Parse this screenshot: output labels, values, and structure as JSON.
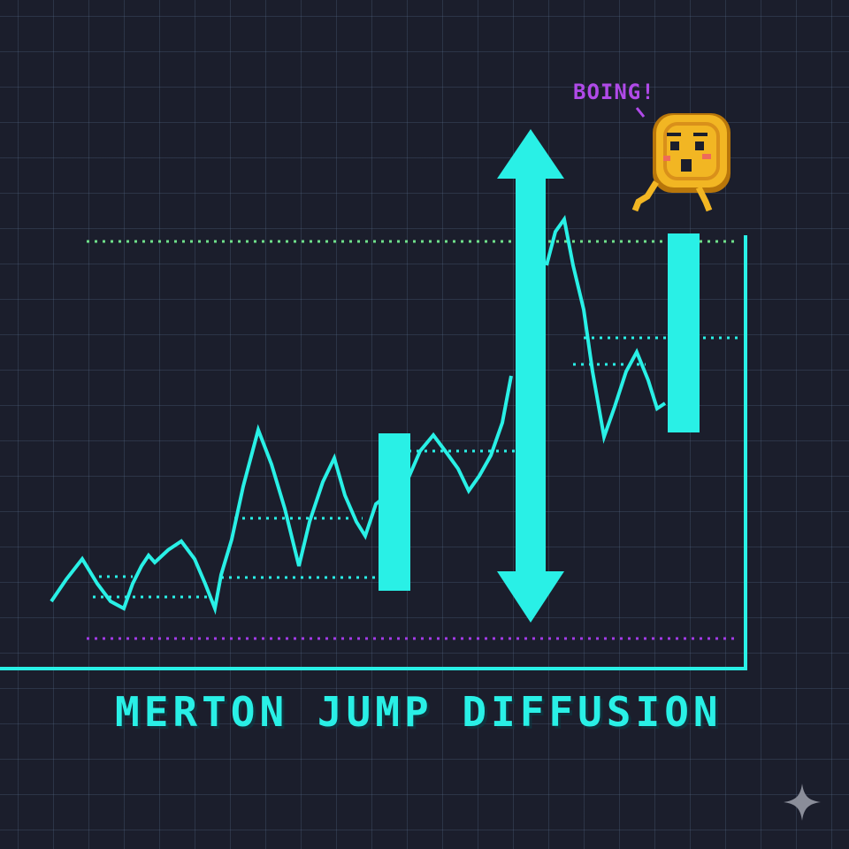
{
  "title": "MERTON JUMP DIFFUSION",
  "mascot": {
    "exclamation": "BOING!",
    "character": "coin",
    "icon": "coin-mascot-icon"
  },
  "colors": {
    "background": "#1b1e2c",
    "primary": "#29f0e6",
    "upper_guide": "#6fe08a",
    "lower_guide": "#a23be6",
    "coin": "#f2b623",
    "exclamation": "#b04ae8"
  },
  "decor": {
    "corner_icon": "sparkle-icon",
    "jump_arrow_icon": "double-arrow-icon"
  }
}
